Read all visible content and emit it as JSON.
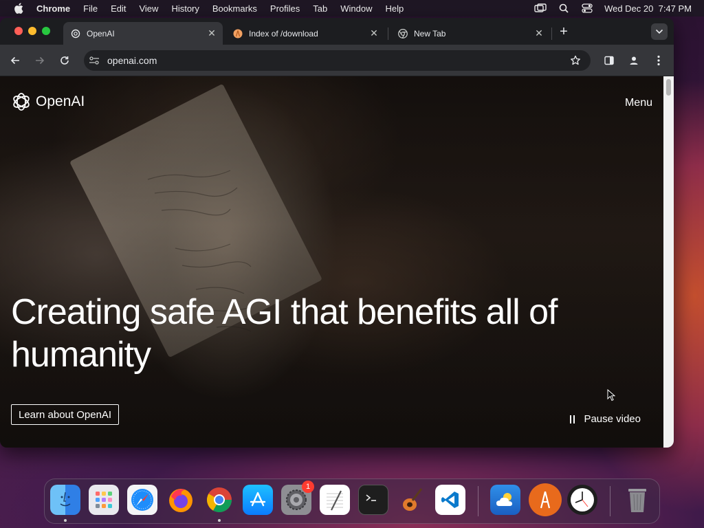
{
  "menubar": {
    "app_name": "Chrome",
    "items": [
      "File",
      "Edit",
      "View",
      "History",
      "Bookmarks",
      "Profiles",
      "Tab",
      "Window",
      "Help"
    ],
    "datetime": "Wed Dec 20  7:47 PM"
  },
  "browser": {
    "tabs": [
      {
        "title": "OpenAI",
        "active": true,
        "icon": "openai-favicon"
      },
      {
        "title": "Index of /download",
        "active": false,
        "icon": "orange-favicon"
      },
      {
        "title": "New Tab",
        "active": false,
        "icon": "chrome-favicon"
      }
    ],
    "url": "openai.com"
  },
  "page": {
    "logo_text": "OpenAI",
    "menu_label": "Menu",
    "headline": "Creating safe AGI that benefits all of humanity",
    "cta_label": "Learn about OpenAI",
    "pause_label": "Pause video"
  },
  "dock": {
    "apps": [
      "Finder",
      "Launchpad",
      "Safari",
      "Firefox",
      "Chrome",
      "App Store",
      "System Settings",
      "TextEdit",
      "Terminal",
      "GarageBand",
      "Visual Studio Code",
      "Weather",
      "Anki",
      "Clock",
      "Trash"
    ],
    "settings_badge": "1"
  },
  "colors": {
    "tab_active": "#35363a",
    "page_text": "#ffffff",
    "traffic_close": "#ff5f57",
    "traffic_min": "#febc2e",
    "traffic_max": "#28c840"
  }
}
